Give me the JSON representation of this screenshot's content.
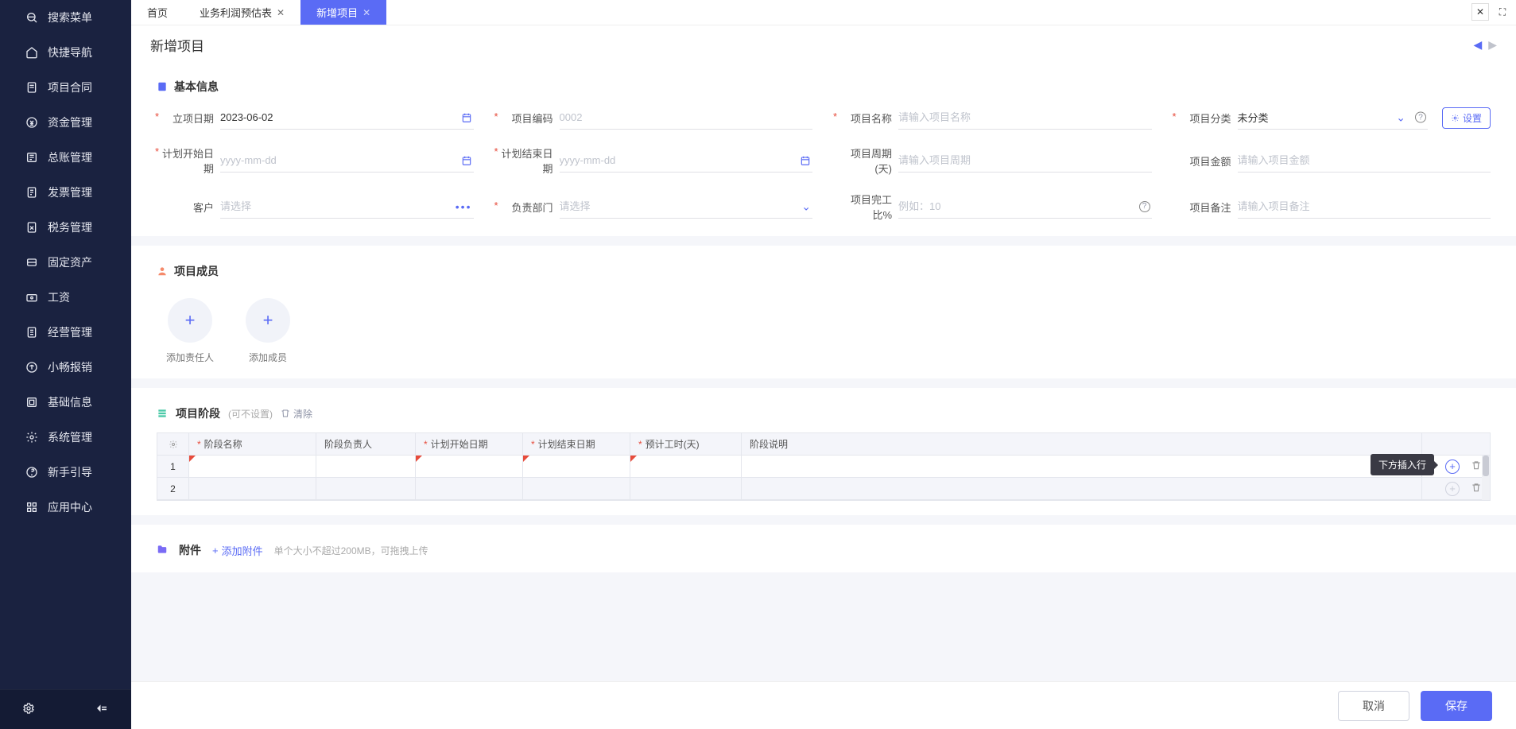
{
  "sidebar": {
    "items": [
      {
        "label": "搜索菜单",
        "icon": "search"
      },
      {
        "label": "快捷导航",
        "icon": "home"
      },
      {
        "label": "项目合同",
        "icon": "doc"
      },
      {
        "label": "资金管理",
        "icon": "money"
      },
      {
        "label": "总账管理",
        "icon": "ledger"
      },
      {
        "label": "发票管理",
        "icon": "invoice"
      },
      {
        "label": "税务管理",
        "icon": "tax"
      },
      {
        "label": "固定资产",
        "icon": "asset"
      },
      {
        "label": "工资",
        "icon": "salary"
      },
      {
        "label": "经营管理",
        "icon": "biz"
      },
      {
        "label": "小畅报销",
        "icon": "expense"
      },
      {
        "label": "基础信息",
        "icon": "basic"
      },
      {
        "label": "系统管理",
        "icon": "system"
      },
      {
        "label": "新手引导",
        "icon": "guide"
      },
      {
        "label": "应用中心",
        "icon": "apps"
      }
    ]
  },
  "tabs": [
    {
      "label": "首页",
      "closable": false
    },
    {
      "label": "业务利润预估表",
      "closable": true
    },
    {
      "label": "新增项目",
      "closable": true,
      "active": true
    }
  ],
  "page": {
    "title": "新增项目"
  },
  "sections": {
    "basic": {
      "title": "基本信息",
      "settings_btn": "设置",
      "fields": {
        "date": {
          "label": "立项日期",
          "value": "2023-06-02"
        },
        "code": {
          "label": "项目编码",
          "value": "0002"
        },
        "name": {
          "label": "项目名称",
          "placeholder": "请输入项目名称"
        },
        "category": {
          "label": "项目分类",
          "value": "未分类"
        },
        "plan_start": {
          "label": "计划开始日期",
          "placeholder": "yyyy-mm-dd"
        },
        "plan_end": {
          "label": "计划结束日期",
          "placeholder": "yyyy-mm-dd"
        },
        "cycle": {
          "label": "项目周期(天)",
          "placeholder": "请输入项目周期"
        },
        "amount": {
          "label": "项目金额",
          "placeholder": "请输入项目金额"
        },
        "customer": {
          "label": "客户",
          "placeholder": "请选择"
        },
        "dept": {
          "label": "负责部门",
          "placeholder": "请选择"
        },
        "progress": {
          "label": "项目完工比%",
          "placeholder": "例如：10"
        },
        "remark": {
          "label": "项目备注",
          "placeholder": "请输入项目备注"
        }
      }
    },
    "members": {
      "title": "项目成员",
      "add_owner": "添加责任人",
      "add_member": "添加成员"
    },
    "stages": {
      "title": "项目阶段",
      "hint": "(可不设置)",
      "clear": "清除",
      "columns": {
        "name": "阶段名称",
        "owner": "阶段负责人",
        "plan_start": "计划开始日期",
        "plan_end": "计划结束日期",
        "est_days": "预计工时(天)",
        "desc": "阶段说明"
      },
      "rows": [
        {
          "idx": "1"
        },
        {
          "idx": "2"
        }
      ],
      "tooltip": "下方插入行"
    },
    "attachments": {
      "title": "附件",
      "add": "添加附件",
      "hint": "单个大小不超过200MB，可拖拽上传"
    }
  },
  "footer": {
    "cancel": "取消",
    "save": "保存"
  }
}
